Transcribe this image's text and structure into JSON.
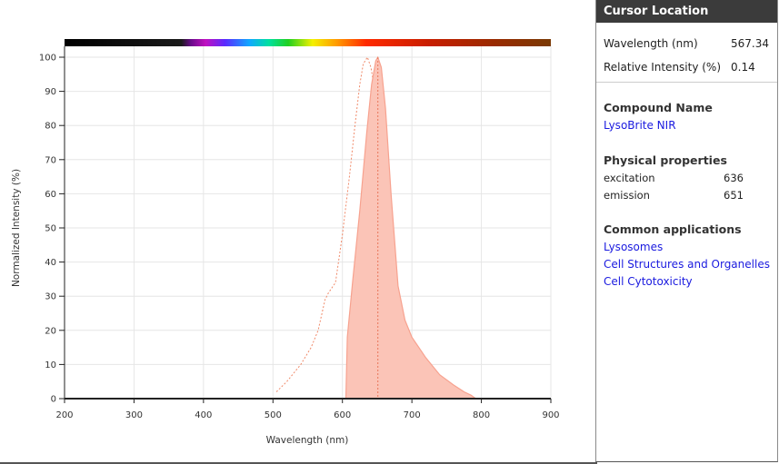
{
  "chart_data": {
    "type": "area",
    "xlabel": "Wavelength (nm)",
    "ylabel": "Normalized Intensity (%)",
    "xlim": [
      200,
      900
    ],
    "ylim": [
      0,
      100
    ],
    "x_ticks": [
      200,
      300,
      400,
      500,
      600,
      700,
      800,
      900
    ],
    "y_ticks": [
      0,
      10,
      20,
      30,
      40,
      50,
      60,
      70,
      80,
      90,
      100
    ],
    "grid": true,
    "spectrum_bar": true,
    "series": [
      {
        "style": "dashed-line",
        "color": "#f08a6a",
        "x": [
          505,
          520,
          540,
          555,
          565,
          575,
          580,
          590,
          600,
          610,
          618,
          625,
          630,
          636,
          641,
          645
        ],
        "y": [
          2,
          5,
          10,
          15,
          20,
          29,
          31,
          34,
          48,
          65,
          80,
          92,
          98,
          100,
          97,
          92
        ]
      },
      {
        "style": "filled-area",
        "color": "#f7a28f",
        "fill": "#fbc4b7",
        "x": [
          605,
          607,
          615,
          625,
          635,
          642,
          648,
          651,
          656,
          662,
          670,
          680,
          690,
          700,
          720,
          740,
          760,
          775,
          785,
          792
        ],
        "y": [
          0,
          18,
          35,
          55,
          78,
          92,
          99,
          100,
          97,
          85,
          60,
          33,
          23,
          18,
          12,
          7,
          4,
          2,
          1,
          0
        ]
      }
    ],
    "marker_lines": [
      {
        "x": 651,
        "style": "dotted",
        "color": "#e8765a"
      }
    ]
  },
  "panel": {
    "header": "Cursor Location",
    "wavelength_label": "Wavelength (nm)",
    "wavelength_value": "567.34",
    "intensity_label": "Relative Intensity (%)",
    "intensity_value": "0.14",
    "compound_title": "Compound Name",
    "compound_name": "LysoBrite NIR",
    "physical_title": "Physical properties",
    "excitation_label": "excitation",
    "excitation_value": "636",
    "emission_label": "emission",
    "emission_value": "651",
    "applications_title": "Common applications",
    "applications": [
      "Lysosomes",
      "Cell Structures and Organelles",
      "Cell Cytotoxicity"
    ]
  }
}
